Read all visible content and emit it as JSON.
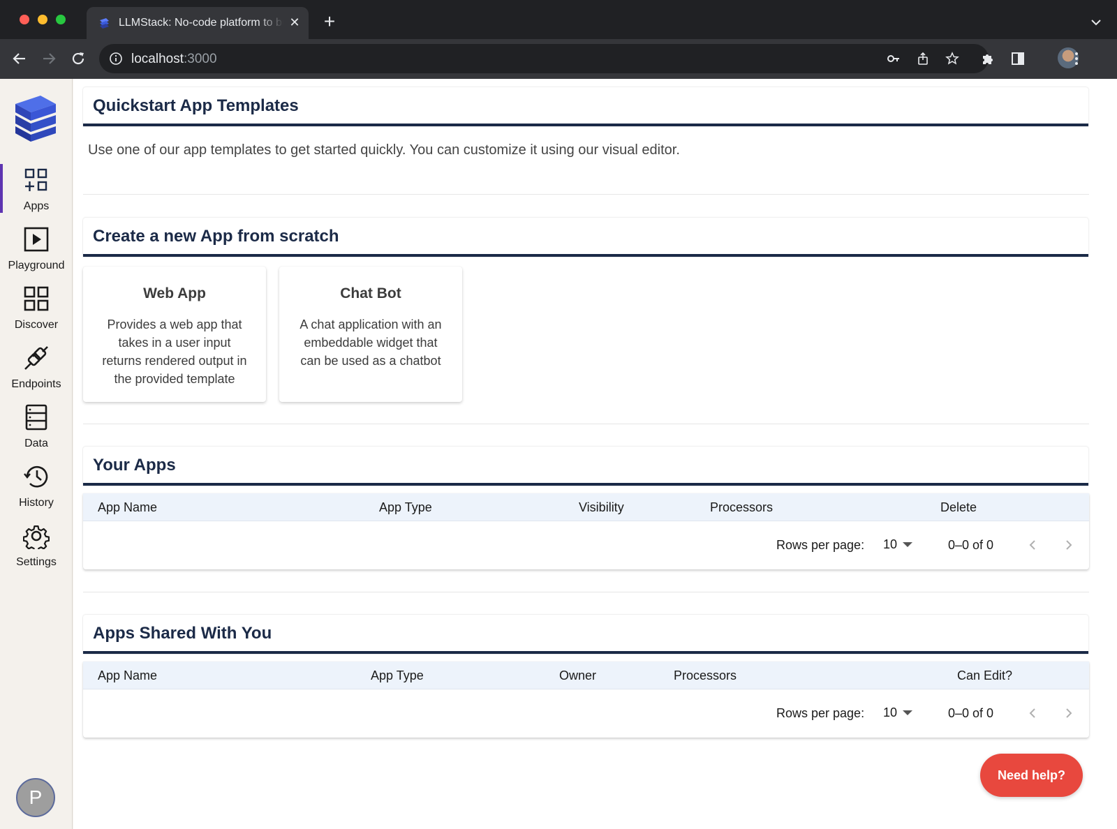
{
  "browser": {
    "tab_title": "LLMStack: No-code platform to build LLM apps",
    "url_host": "localhost",
    "url_port": ":3000",
    "new_tab": "+",
    "close": "✕"
  },
  "sidebar": {
    "items": [
      {
        "label": "Apps",
        "icon": "apps-icon",
        "active": true
      },
      {
        "label": "Playground",
        "icon": "play-icon"
      },
      {
        "label": "Discover",
        "icon": "grid-icon"
      },
      {
        "label": "Endpoints",
        "icon": "plug-icon"
      },
      {
        "label": "Data",
        "icon": "database-icon"
      },
      {
        "label": "History",
        "icon": "history-icon"
      },
      {
        "label": "Settings",
        "icon": "gear-icon"
      }
    ],
    "avatar_initial": "P"
  },
  "quickstart": {
    "title": "Quickstart App Templates",
    "description": "Use one of our app templates to get started quickly. You can customize it using our visual editor."
  },
  "create": {
    "title": "Create a new App from scratch",
    "cards": [
      {
        "title": "Web App",
        "description": "Provides a web app that takes in a user input returns rendered output in the provided template"
      },
      {
        "title": "Chat Bot",
        "description": "A chat application with an embeddable widget that can be used as a chatbot"
      }
    ]
  },
  "your_apps": {
    "title": "Your Apps",
    "columns": [
      "App Name",
      "App Type",
      "Visibility",
      "Processors",
      "Delete"
    ],
    "rows_per_page_label": "Rows per page:",
    "rows_per_page": "10",
    "range": "0–0 of 0"
  },
  "shared_apps": {
    "title": "Apps Shared With You",
    "columns": [
      "App Name",
      "App Type",
      "Owner",
      "Processors",
      "Can Edit?"
    ],
    "rows_per_page_label": "Rows per page:",
    "rows_per_page": "10",
    "range": "0–0 of 0"
  },
  "help": {
    "label": "Need help?"
  },
  "colors": {
    "accent": "#5e35b1",
    "header_text": "#1b2a47",
    "table_header_bg": "#edf3fb",
    "help_button": "#e8483e"
  }
}
